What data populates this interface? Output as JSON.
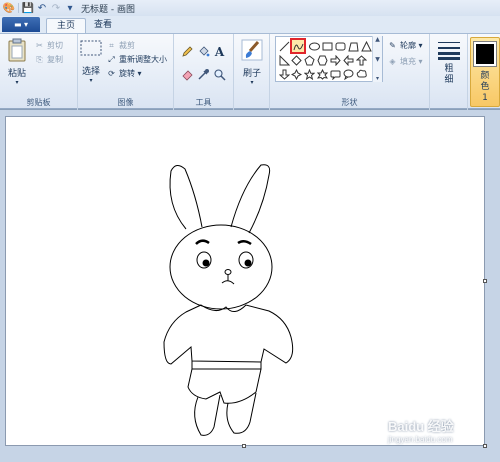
{
  "app": {
    "window_title": "无标题 - 画图"
  },
  "quick_access": [
    {
      "name": "save-icon",
      "glyph": "▣"
    },
    {
      "name": "undo-icon",
      "glyph": "↶"
    },
    {
      "name": "redo-icon",
      "glyph": "↷"
    },
    {
      "name": "customize-dropdown-icon",
      "glyph": "▾"
    }
  ],
  "tabs": {
    "app_menu": "▬ ▾",
    "home": "主页",
    "view": "查看"
  },
  "clipboard": {
    "paste": "粘贴",
    "cut": "剪切",
    "copy": "复制",
    "label": "剪贴板"
  },
  "image": {
    "select": "选择",
    "crop": "裁剪",
    "resize": "重新调整大小",
    "rotate": "旋转 ▾",
    "label": "图像"
  },
  "tools": {
    "label": "工具",
    "text_glyph": "A"
  },
  "brushes": {
    "label": "刷子"
  },
  "shapes": {
    "outline": "轮廓 ▾",
    "fill": "填充 ▾",
    "label": "形状"
  },
  "size": {
    "label": "粗细"
  },
  "colors": {
    "color1": "颜色 1",
    "color1_value": "#000000",
    "selected_shape_highlight": "#e0262b"
  },
  "watermark": {
    "text": "Baidu 经验",
    "url": "jingyan.baidu.com"
  }
}
